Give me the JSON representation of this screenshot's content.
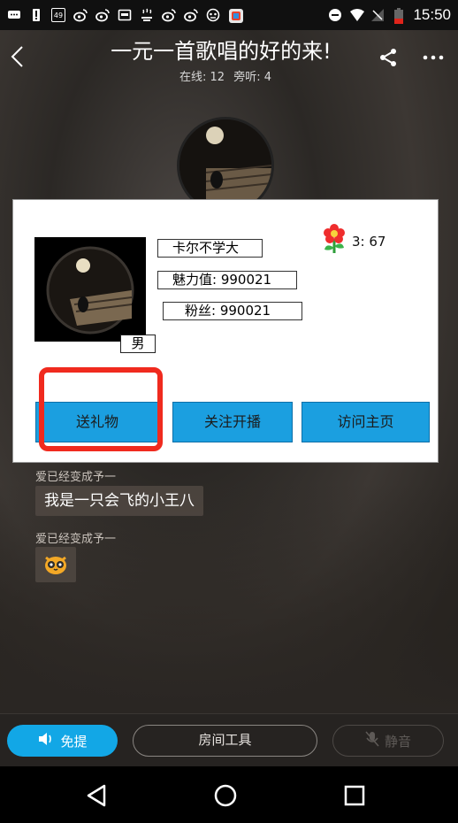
{
  "status_bar": {
    "time": "15:50",
    "notification_badge": "49",
    "icons": [
      "chat-bubble-icon",
      "alert-icon",
      "badge-icon",
      "weibo-icon",
      "weibo-icon",
      "mail-icon",
      "steam-icon",
      "weibo-icon",
      "weibo-icon",
      "game-icon",
      "app-icon",
      "do-not-disturb-icon",
      "wifi-icon",
      "no-signal-icon",
      "battery-icon"
    ]
  },
  "header": {
    "title": "一元一首歌唱的好的来!",
    "online_label": "在线: 12",
    "listener_label": "旁听: 4"
  },
  "profile_card": {
    "username": "卡尔不学大",
    "charm": "魅力值: 990021",
    "fans": "粉丝: 990021",
    "gender": "男",
    "flower_count": "3: 67",
    "buttons": {
      "gift": "送礼物",
      "follow": "关注开播",
      "visit": "访问主页"
    }
  },
  "chat": [
    {
      "user": "爱已经变成予一",
      "message": "我是一只会飞的小王八"
    },
    {
      "user": "爱已经变成予一",
      "message": ""
    }
  ],
  "controls": {
    "mic_label": "免提",
    "tools_label": "房间工具",
    "mute_label": "静音"
  },
  "colors": {
    "accent_blue": "#1b9fe0",
    "highlight_red": "#f02a1e",
    "mic_blue": "#12a7e6"
  }
}
